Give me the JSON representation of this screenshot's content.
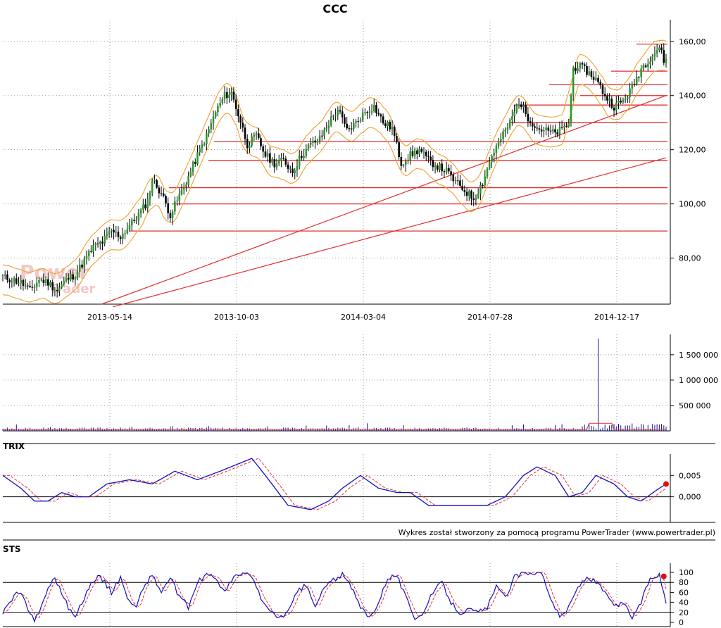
{
  "chart_data": {
    "type": "candlestick",
    "title": "CCC",
    "credit": "Wykres został stworzony za pomocą programu PowerTrader (www.powertrader.pl)",
    "watermark": [
      "Power",
      "Trader"
    ],
    "x_ticks": [
      "2013-05-14",
      "2013-10-03",
      "2014-03-04",
      "2014-07-28",
      "2014-12-17"
    ],
    "price": {
      "y_ticks": [
        "80,00",
        "100,00",
        "120,00",
        "140,00",
        "160,00"
      ],
      "ylim": [
        63,
        168
      ],
      "close_anchors": [
        [
          0,
          73
        ],
        [
          4,
          72
        ],
        [
          8,
          71
        ],
        [
          12,
          68
        ],
        [
          16,
          72
        ],
        [
          20,
          71
        ],
        [
          24,
          68
        ],
        [
          28,
          72
        ],
        [
          32,
          74
        ],
        [
          36,
          79
        ],
        [
          40,
          84
        ],
        [
          44,
          86
        ],
        [
          48,
          90
        ],
        [
          52,
          88
        ],
        [
          56,
          92
        ],
        [
          60,
          96
        ],
        [
          64,
          101
        ],
        [
          66,
          109
        ],
        [
          70,
          104
        ],
        [
          74,
          96
        ],
        [
          78,
          103
        ],
        [
          82,
          110
        ],
        [
          86,
          118
        ],
        [
          90,
          125
        ],
        [
          94,
          134
        ],
        [
          98,
          140
        ],
        [
          101,
          141
        ],
        [
          104,
          133
        ],
        [
          108,
          122
        ],
        [
          112,
          125
        ],
        [
          116,
          118
        ],
        [
          120,
          115
        ],
        [
          124,
          116
        ],
        [
          128,
          112
        ],
        [
          132,
          118
        ],
        [
          136,
          122
        ],
        [
          140,
          124
        ],
        [
          144,
          130
        ],
        [
          148,
          135
        ],
        [
          152,
          127
        ],
        [
          156,
          130
        ],
        [
          160,
          134
        ],
        [
          164,
          136
        ],
        [
          168,
          130
        ],
        [
          172,
          128
        ],
        [
          176,
          115
        ],
        [
          180,
          118
        ],
        [
          184,
          120
        ],
        [
          188,
          116
        ],
        [
          192,
          114
        ],
        [
          196,
          112
        ],
        [
          200,
          108
        ],
        [
          204,
          105
        ],
        [
          208,
          102
        ],
        [
          212,
          108
        ],
        [
          216,
          118
        ],
        [
          220,
          124
        ],
        [
          224,
          130
        ],
        [
          228,
          138
        ],
        [
          232,
          132
        ],
        [
          236,
          128
        ],
        [
          240,
          127
        ],
        [
          244,
          126
        ],
        [
          248,
          128
        ],
        [
          250,
          130
        ],
        [
          252,
          150
        ],
        [
          254,
          151
        ],
        [
          258,
          149
        ],
        [
          262,
          146
        ],
        [
          266,
          140
        ],
        [
          270,
          136
        ],
        [
          274,
          138
        ],
        [
          278,
          143
        ],
        [
          282,
          150
        ],
        [
          286,
          154
        ],
        [
          290,
          158
        ],
        [
          292,
          153
        ]
      ],
      "hlines": [
        159,
        149,
        144,
        140,
        136.5,
        130,
        123,
        116,
        106,
        100,
        90
      ],
      "trendlines": [
        [
          [
            25,
            63
          ],
          [
            293,
            140
          ]
        ],
        [
          [
            30,
            62
          ],
          [
            293,
            117
          ]
        ]
      ],
      "bands": [
        {
          "name": "upper band",
          "color": "#f0a030",
          "offset": 5
        },
        {
          "name": "lower band",
          "color": "#f0a030",
          "offset": -6
        }
      ]
    },
    "volume": {
      "y_ticks": [
        "500 000",
        "1 000 000",
        "1 500 000"
      ],
      "ylim": [
        0,
        1900000
      ],
      "spike": {
        "x": 263,
        "value": 1820000
      }
    },
    "trix": {
      "name": "TRIX",
      "y_ticks": [
        "0,000",
        "0,005"
      ],
      "ylim": [
        -0.006,
        0.01
      ],
      "anchors": [
        [
          0,
          0.005
        ],
        [
          8,
          0.002
        ],
        [
          14,
          -0.001
        ],
        [
          20,
          -0.001
        ],
        [
          26,
          0.001
        ],
        [
          32,
          0.0
        ],
        [
          38,
          0.0
        ],
        [
          46,
          0.003
        ],
        [
          56,
          0.004
        ],
        [
          66,
          0.003
        ],
        [
          76,
          0.006
        ],
        [
          86,
          0.004
        ],
        [
          96,
          0.006
        ],
        [
          110,
          0.009
        ],
        [
          116,
          0.005
        ],
        [
          126,
          -0.002
        ],
        [
          136,
          -0.003
        ],
        [
          144,
          -0.001
        ],
        [
          150,
          0.002
        ],
        [
          158,
          0.005
        ],
        [
          166,
          0.002
        ],
        [
          174,
          0.001
        ],
        [
          180,
          0.001
        ],
        [
          188,
          -0.002
        ],
        [
          196,
          -0.002
        ],
        [
          206,
          -0.002
        ],
        [
          214,
          -0.002
        ],
        [
          222,
          0.0
        ],
        [
          230,
          0.005
        ],
        [
          236,
          0.007
        ],
        [
          244,
          0.005
        ],
        [
          250,
          0.0
        ],
        [
          256,
          0.001
        ],
        [
          262,
          0.005
        ],
        [
          270,
          0.003
        ],
        [
          276,
          0.0
        ],
        [
          282,
          -0.001
        ],
        [
          290,
          0.002
        ],
        [
          293,
          0.003
        ]
      ]
    },
    "sts": {
      "name": "STS",
      "y_ticks": [
        "0",
        "20",
        "40",
        "60",
        "80",
        "100"
      ],
      "ylim": [
        0,
        100
      ],
      "levels": [
        20,
        80
      ],
      "anchors": [
        [
          0,
          20
        ],
        [
          3,
          40
        ],
        [
          6,
          60
        ],
        [
          9,
          50
        ],
        [
          12,
          20
        ],
        [
          14,
          5
        ],
        [
          17,
          30
        ],
        [
          20,
          70
        ],
        [
          23,
          90
        ],
        [
          26,
          60
        ],
        [
          29,
          30
        ],
        [
          32,
          10
        ],
        [
          35,
          40
        ],
        [
          38,
          70
        ],
        [
          42,
          95
        ],
        [
          45,
          80
        ],
        [
          48,
          60
        ],
        [
          52,
          90
        ],
        [
          56,
          40
        ],
        [
          59,
          30
        ],
        [
          62,
          70
        ],
        [
          66,
          95
        ],
        [
          70,
          60
        ],
        [
          74,
          90
        ],
        [
          78,
          50
        ],
        [
          82,
          30
        ],
        [
          86,
          80
        ],
        [
          90,
          95
        ],
        [
          94,
          90
        ],
        [
          98,
          60
        ],
        [
          102,
          90
        ],
        [
          106,
          98
        ],
        [
          110,
          92
        ],
        [
          114,
          50
        ],
        [
          118,
          20
        ],
        [
          122,
          10
        ],
        [
          126,
          20
        ],
        [
          130,
          60
        ],
        [
          134,
          75
        ],
        [
          138,
          30
        ],
        [
          142,
          70
        ],
        [
          146,
          85
        ],
        [
          150,
          95
        ],
        [
          154,
          70
        ],
        [
          158,
          30
        ],
        [
          162,
          10
        ],
        [
          166,
          40
        ],
        [
          170,
          90
        ],
        [
          174,
          95
        ],
        [
          178,
          50
        ],
        [
          182,
          10
        ],
        [
          186,
          20
        ],
        [
          190,
          60
        ],
        [
          194,
          80
        ],
        [
          198,
          40
        ],
        [
          202,
          20
        ],
        [
          206,
          25
        ],
        [
          210,
          20
        ],
        [
          214,
          30
        ],
        [
          218,
          70
        ],
        [
          222,
          50
        ],
        [
          226,
          90
        ],
        [
          230,
          100
        ],
        [
          234,
          100
        ],
        [
          238,
          100
        ],
        [
          242,
          50
        ],
        [
          246,
          10
        ],
        [
          250,
          30
        ],
        [
          254,
          70
        ],
        [
          258,
          90
        ],
        [
          262,
          80
        ],
        [
          266,
          60
        ],
        [
          270,
          30
        ],
        [
          274,
          40
        ],
        [
          278,
          10
        ],
        [
          282,
          40
        ],
        [
          286,
          90
        ],
        [
          290,
          95
        ],
        [
          293,
          40
        ]
      ]
    }
  }
}
